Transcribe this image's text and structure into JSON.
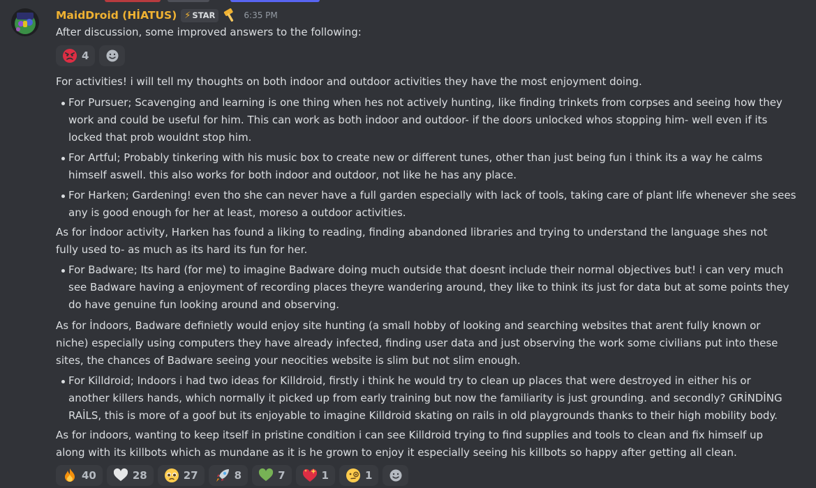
{
  "message": {
    "author": "MaidDroid (HİATUS)",
    "tag_label": "STAR",
    "tag_icon": "lightning-bolt",
    "timestamp": "6:35 PM",
    "intro": "After discussion, some improved answers to the following:",
    "intro_reactions": [
      {
        "emoji": "angry-face",
        "count": "4"
      }
    ],
    "blocks": [
      {
        "type": "p",
        "lines": [
          "For activities! i will tell my thoughts on both indoor and outdoor activities they have the most enjoyment doing."
        ]
      },
      {
        "type": "li",
        "lines": [
          "For Pursuer; Scavenging and learning is one thing when hes not actively hunting, like finding trinkets from corpses and seeing how they",
          "work and could be useful for him. This can work as both indoor and outdoor- if the doors unlocked whos stopping him- well even if its",
          "locked that prob wouldnt stop him."
        ]
      },
      {
        "type": "li",
        "lines": [
          "For Artful; Probably tinkering with his music box to create new or different tunes, other than just being fun i think its a way he calms",
          "himself aswell. this also works for both indoor and outdoor, not like he has any place."
        ]
      },
      {
        "type": "li",
        "lines": [
          "For Harken; Gardening! even tho she can never have a full garden especially with lack of tools, taking care of plant life whenever she sees",
          "any is good enough for her at least, moreso a outdoor activities."
        ]
      },
      {
        "type": "p",
        "lines": [
          "As for İndoor activity, Harken has found a liking to reading, finding abandoned libraries and trying to understand the language shes not",
          "fully used to- as much as its hard its fun for her."
        ]
      },
      {
        "type": "li",
        "lines": [
          "For Badware; Its hard (for me) to imagine Badware doing much outside that doesnt include their normal objectives but! i can very much",
          "see Badware having a enjoyment of recording places theyre wandering around, they like to think its just for data but at some points they",
          "do have genuine fun looking around and observing."
        ]
      },
      {
        "type": "p",
        "lines": [
          "As for İndoors, Badware definietly would enjoy site hunting (a small hobby of looking and searching websites that arent fully known or",
          "niche) especially using computers they have already infected, finding user data and just observing the work some civilians put into these",
          "sites, the chances of Badware seeing your neocities website is slim but not slim enough."
        ]
      },
      {
        "type": "li",
        "lines": [
          "For Killdroid; Indoors i had two ideas for Killdroid, firstly i think he would try to clean up places that were destroyed in either his or",
          "another killers hands, which normally it picked up from early training but now the familiarity is just grounding. and secondly? GRİNDİNG",
          "RAİLS, this is more of a goof but its enjoyable to imagine Killdroid skating on rails in old playgrounds thanks to their high mobility body."
        ]
      },
      {
        "type": "p",
        "lines": [
          "As for indoors, wanting to keep itself in pristine condition i can see Killdroid trying to find supplies and tools to clean and fix himself up",
          "along with its killbots which as mundane as it is he grown to enjoy it especially seeing his killbots so happy after getting all clean."
        ]
      }
    ],
    "reactions": [
      {
        "emoji": "fire",
        "count": "40"
      },
      {
        "emoji": "white-heart",
        "count": "28"
      },
      {
        "emoji": "pleading-face",
        "count": "27"
      },
      {
        "emoji": "rocket",
        "count": "8"
      },
      {
        "emoji": "green-heart",
        "count": "7"
      },
      {
        "emoji": "sparkling-heart",
        "count": "1"
      },
      {
        "emoji": "monocle-face",
        "count": "1"
      }
    ]
  },
  "colors": {
    "background": "#313338",
    "username": "#f0b232",
    "text": "#dbdee1",
    "muted": "#949ba4",
    "reaction_bg": "#393b40"
  }
}
